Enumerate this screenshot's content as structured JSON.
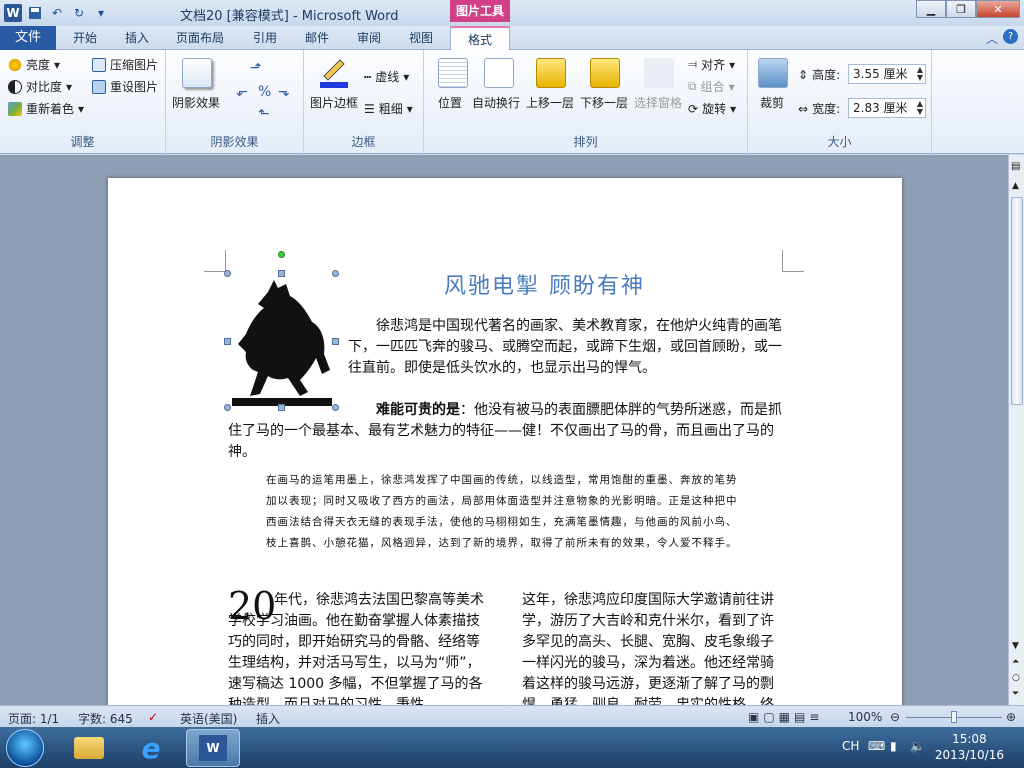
{
  "window": {
    "title": "文档20 [兼容模式] - Microsoft Word",
    "contextual_group": "图片工具"
  },
  "qat": {
    "save": "保存",
    "undo": "撤销",
    "redo": "恢复"
  },
  "tabs": [
    "文件",
    "开始",
    "插入",
    "页面布局",
    "引用",
    "邮件",
    "审阅",
    "视图",
    "格式"
  ],
  "ribbon": {
    "adjust": {
      "label": "调整",
      "brightness": "亮度",
      "contrast": "对比度",
      "recolor": "重新着色",
      "compress": "压缩图片",
      "reset": "重设图片"
    },
    "shadow": {
      "label": "阴影效果",
      "shadow_btn": "阴影效果"
    },
    "border": {
      "label": "边框",
      "picture_border": "图片边框",
      "dashes": "虚线",
      "weight": "粗细"
    },
    "arrange": {
      "label": "排列",
      "position": "位置",
      "wrap": "自动换行",
      "bring_forward": "上移一层",
      "send_backward": "下移一层",
      "selection_pane": "选择窗格",
      "align": "对齐",
      "group": "组合",
      "rotate": "旋转"
    },
    "size": {
      "label": "大小",
      "crop": "裁剪",
      "height_label": "高度:",
      "height_value": "3.55 厘米",
      "width_label": "宽度:",
      "width_value": "2.83 厘米"
    }
  },
  "document": {
    "heading": "风驰电掣  顾盼有神",
    "para1": "徐悲鸿是中国现代著名的画家、美术教育家，在他炉火纯青的画笔下，一匹匹飞奔的骏马、或腾空而起，或蹄下生烟，或回首顾盼，或一往直前。即使是低头饮水的，也显示出马的悍气。",
    "para2_bold": "难能可贵的是",
    "para2": "：他没有被马的表面膘肥体胖的气势所迷惑，而是抓住了马的一个最基本、最有艺术魅力的特征——健！不仅画出了马的骨，而且画出了马的神。",
    "quote": "在画马的运笔用墨上，徐悲鸿发挥了中国画的传统，以线造型，常用饱酣的重墨、奔放的笔势加以表现；同时又吸收了西方的画法，局部用体面造型并注意物象的光影明暗。正是这种把中西画法结合得天衣无缝的表现手法，使他的马栩栩如生，充满笔墨情趣，与他画的风前小鸟、枝上喜鹊、小憩花猫，风格迥异，达到了新的境界，取得了前所未有的效果，令人爱不释手。",
    "dropcap": "20",
    "col1": "年代，徐悲鸿去法国巴黎高等美术学校学习油画。他在勤奋掌握人体素描技巧的同时，即开始研究马的骨骼、经络等生理结构，并对活马写生，以马为“师”，速写稿达 1000 多幅，不但掌握了马的各种造型，而且对马的习性、秉性",
    "col2": "这年，徐悲鸿应印度国际大学邀请前往讲学，游历了大吉岭和克什米尔，看到了许多罕见的高头、长腿、宽胸、皮毛象缎子一样闪光的骏马，深为着迷。他还经常骑着这样的骏马远游，更逐渐了解了马的剽悍、勇猛、驯良、耐劳、忠实的性格，终"
  },
  "status": {
    "page": "页面: 1/1",
    "words": "字数: 645",
    "lang": "英语(美国)",
    "mode": "插入",
    "zoom": "100%"
  },
  "zoom_level": 100,
  "taskbar": {
    "lang": "CH",
    "time": "15:08",
    "date": "2013/10/16"
  },
  "colors": {
    "file_tab": "#2a5aa5",
    "picture_tools": "#d13f86",
    "heading": "#4a7bbf"
  }
}
